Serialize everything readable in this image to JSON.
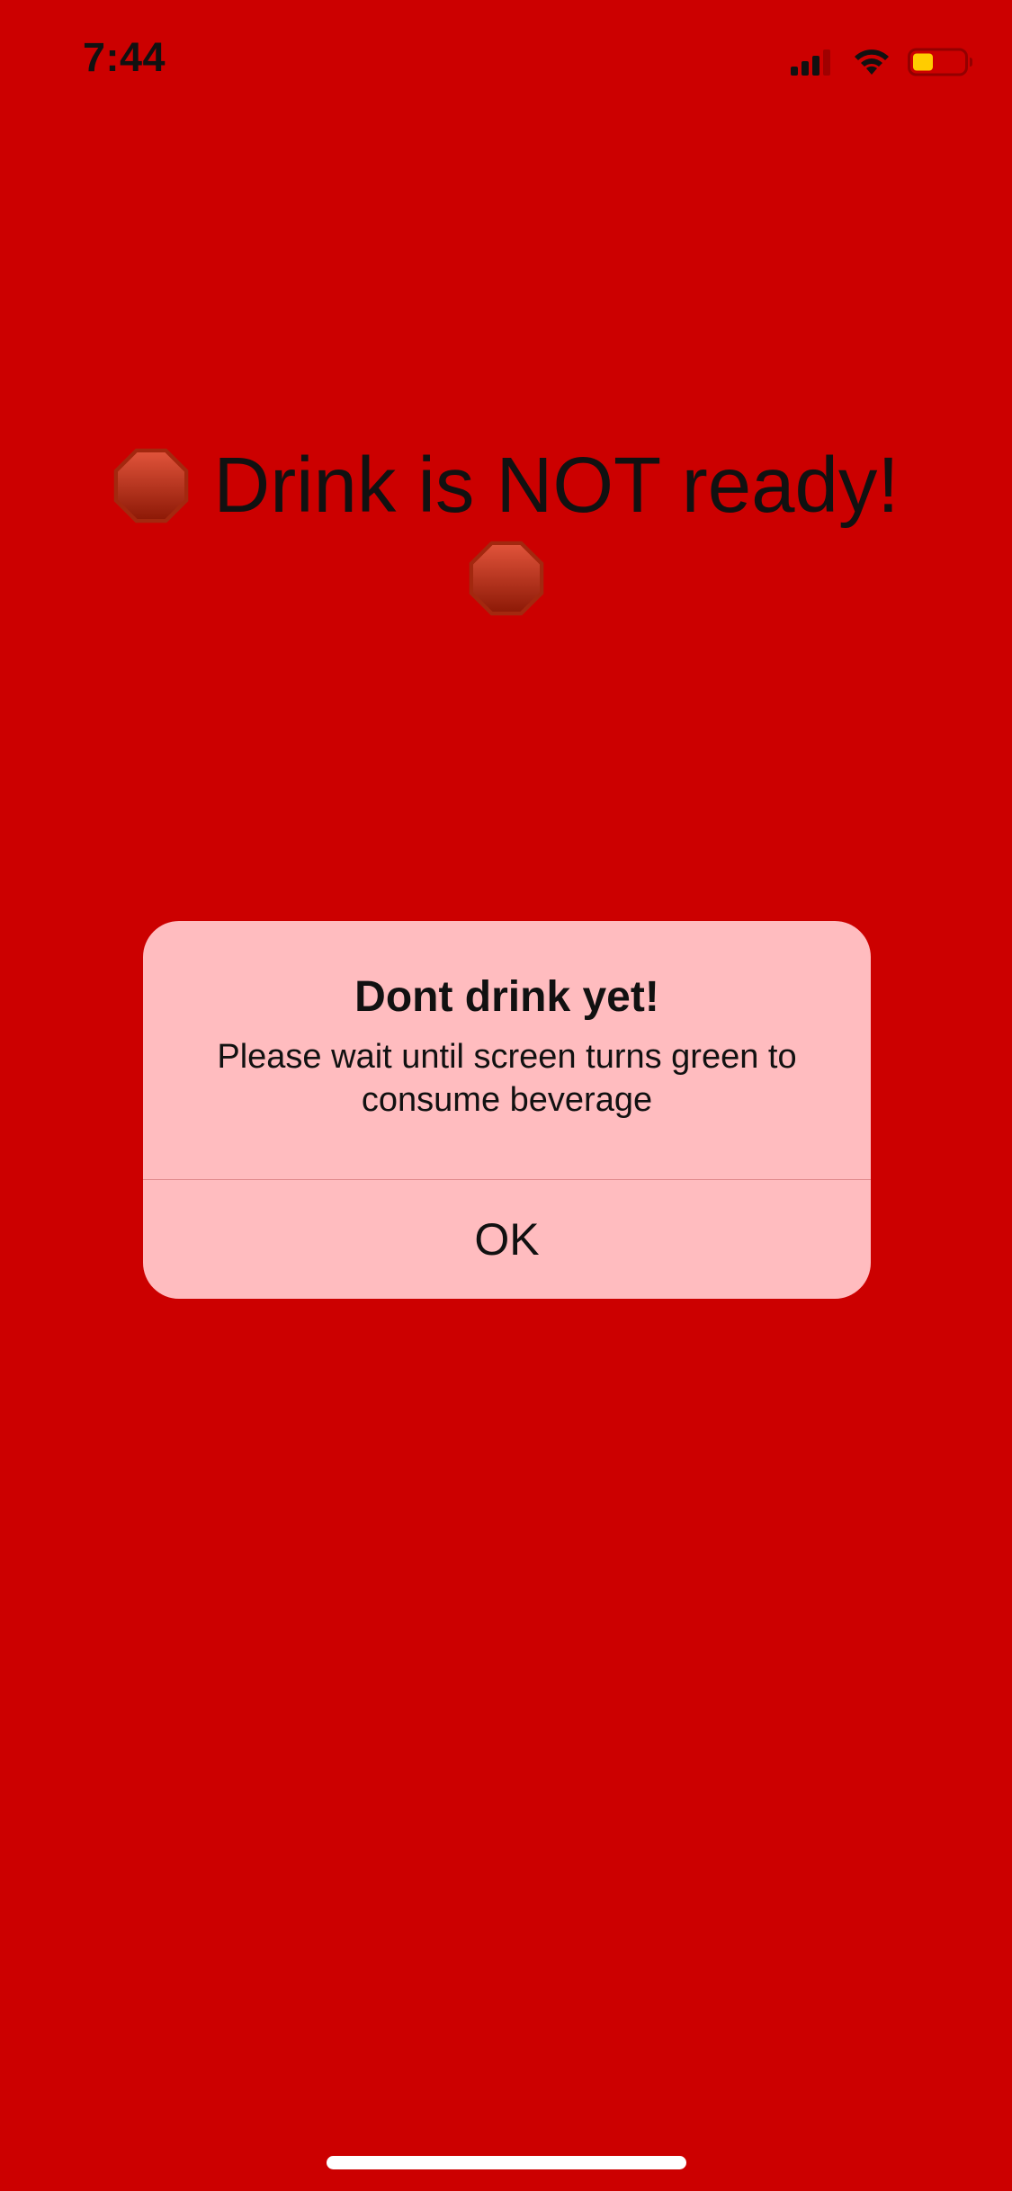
{
  "status_bar": {
    "time": "7:44",
    "icons": [
      "cellular-signal-icon",
      "wifi-icon",
      "battery-icon"
    ],
    "battery_level": 0.4,
    "battery_color": "#ffcc00"
  },
  "background_color": "#cc0000",
  "headline": {
    "text": "Drink is NOT ready!",
    "icon": "stop-sign-icon"
  },
  "alert": {
    "title": "Dont drink yet!",
    "message": "Please wait until screen turns green to consume beverage",
    "button_label": "OK",
    "background_color": "#ffbcbf"
  }
}
